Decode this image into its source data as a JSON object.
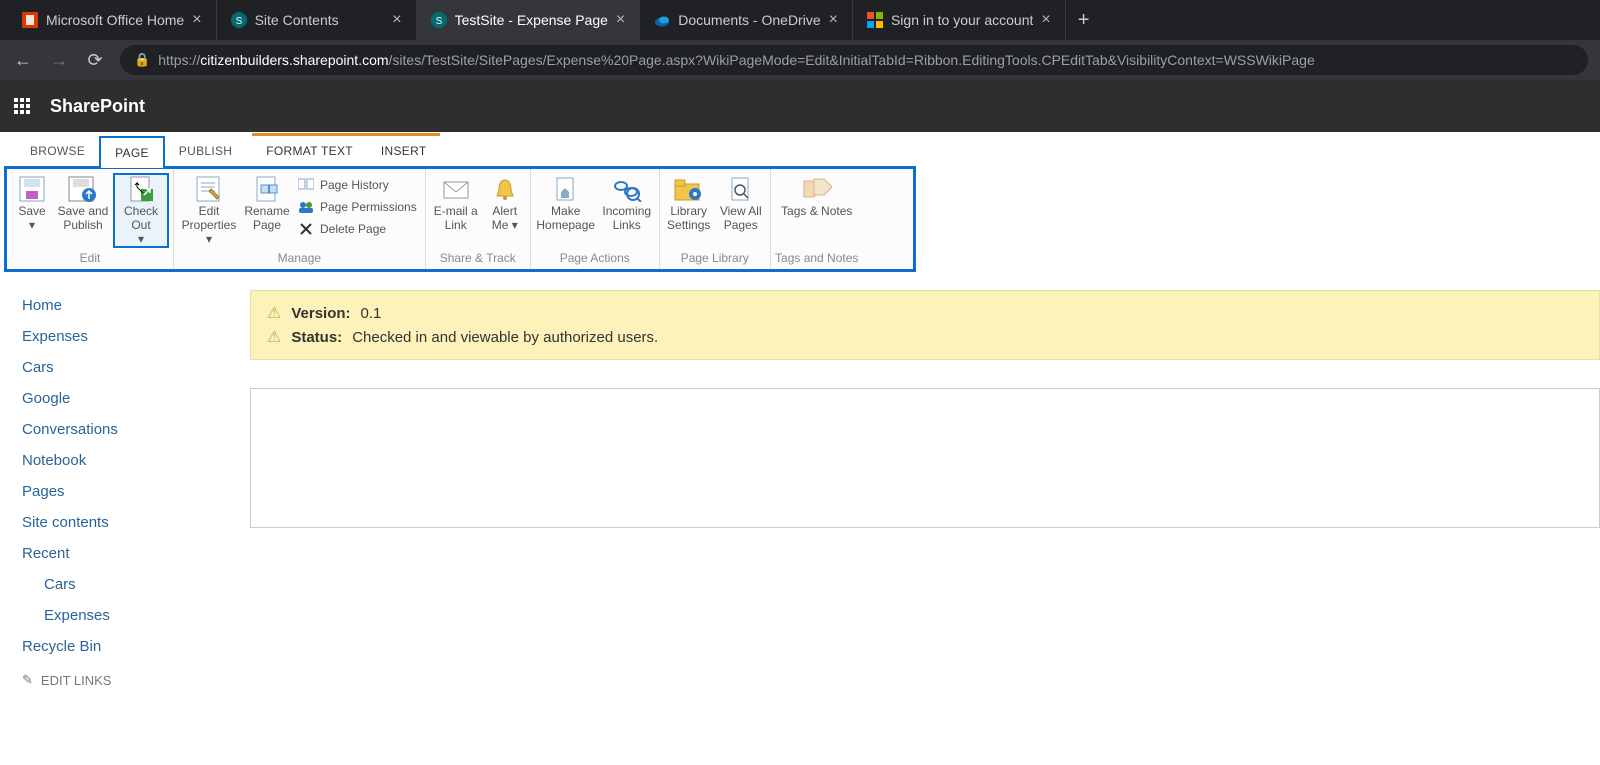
{
  "browser": {
    "tabs": [
      {
        "label": "Microsoft Office Home",
        "icon": "office",
        "active": false
      },
      {
        "label": "Site Contents",
        "icon": "sp",
        "active": false
      },
      {
        "label": "TestSite - Expense Page",
        "icon": "sp",
        "active": true
      },
      {
        "label": "Documents - OneDrive",
        "icon": "onedrive",
        "active": false
      },
      {
        "label": "Sign in to your account",
        "icon": "ms",
        "active": false
      }
    ],
    "url_host": "citizenbuilders.sharepoint.com",
    "url_prefix": "https://",
    "url_path": "/sites/TestSite/SitePages/Expense%20Page.aspx?WikiPageMode=Edit&InitialTabId=Ribbon.EditingTools.CPEditTab&VisibilityContext=WSSWikiPage"
  },
  "suite": {
    "brand": "SharePoint"
  },
  "ribbon_tabs": {
    "browse": "BROWSE",
    "page": "PAGE",
    "publish": "PUBLISH",
    "format_text": "FORMAT TEXT",
    "insert": "INSERT"
  },
  "ribbon": {
    "edit": {
      "label": "Edit",
      "save": "Save",
      "save_publish": "Save and Publish",
      "check_out": "Check Out"
    },
    "manage": {
      "label": "Manage",
      "edit_properties": "Edit Properties",
      "rename_page": "Rename Page",
      "page_history": "Page History",
      "page_permissions": "Page Permissions",
      "delete_page": "Delete Page"
    },
    "share_track": {
      "label": "Share & Track",
      "email_link": "E-mail a Link",
      "alert_me": "Alert Me"
    },
    "page_actions": {
      "label": "Page Actions",
      "make_homepage": "Make Homepage",
      "incoming_links": "Incoming Links"
    },
    "page_library": {
      "label": "Page Library",
      "library_settings": "Library Settings",
      "view_all_pages": "View All Pages"
    },
    "tags_notes": {
      "label": "Tags and Notes",
      "tags_notes": "Tags & Notes"
    }
  },
  "left_nav": {
    "items": [
      "Home",
      "Expenses",
      "Cars",
      "Google",
      "Conversations",
      "Notebook",
      "Pages",
      "Site contents",
      "Recent"
    ],
    "recent": [
      "Cars",
      "Expenses"
    ],
    "recycle": "Recycle Bin",
    "edit_links": "EDIT LINKS"
  },
  "status": {
    "version_label": "Version:",
    "version_value": "0.1",
    "status_label": "Status:",
    "status_value": "Checked in and viewable by authorized users."
  }
}
